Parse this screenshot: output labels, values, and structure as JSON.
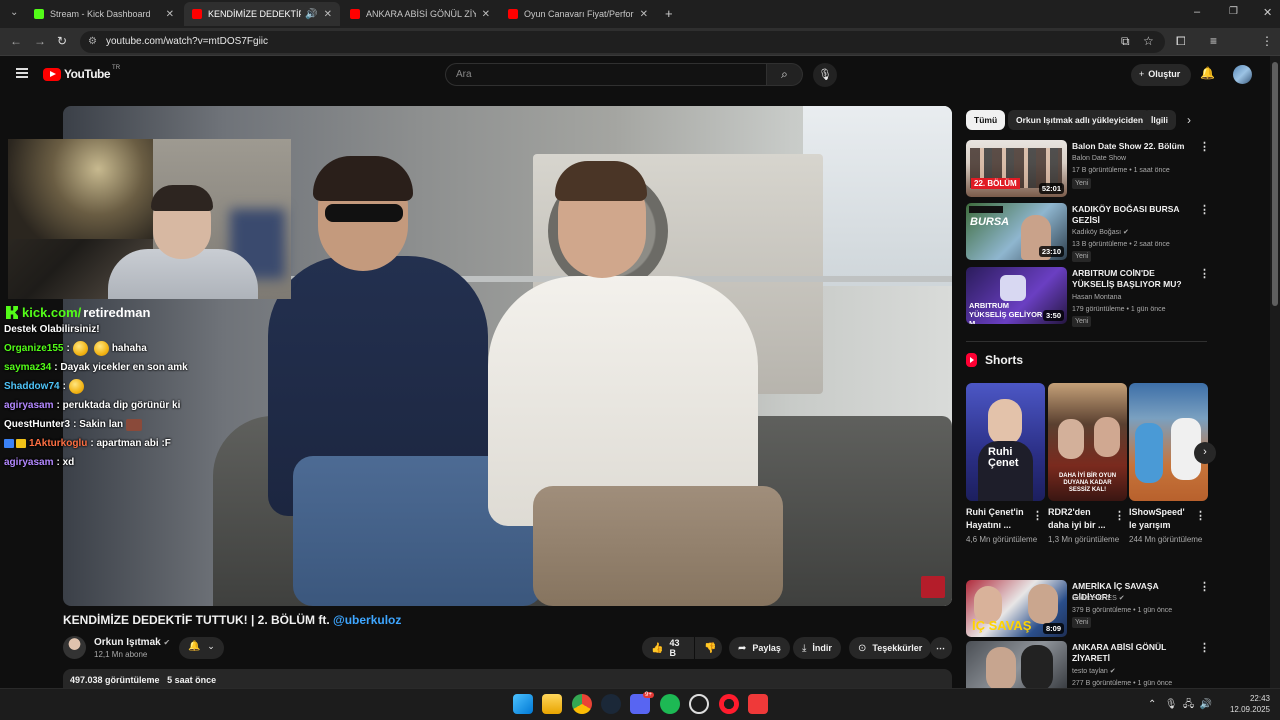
{
  "browser": {
    "tabs": [
      {
        "title": "Stream - Kick Dashboard",
        "favicon": "kick-icon",
        "active": false
      },
      {
        "title": "KENDİMİZE DEDEKTİF TUTT",
        "favicon": "youtube-icon",
        "active": true,
        "audio": true
      },
      {
        "title": "ANKARA ABİSİ GÖNÜL ZİYARE",
        "favicon": "youtube-icon",
        "active": false
      },
      {
        "title": "Oyun Canavarı Fiyat/Performan",
        "favicon": "youtube-icon",
        "active": false
      }
    ],
    "url": "youtube.com/watch?v=mtDOS7Fgiic"
  },
  "youtube": {
    "logo_text": "YouTube",
    "region": "TR",
    "search_placeholder": "Ara",
    "create_label": "Oluştur"
  },
  "video": {
    "title_main": "KENDİMİZE DEDEKTİF TUTTUK! | 2. BÖLÜM ft.",
    "title_mention": "@uberkuloz",
    "channel": "Orkun Işıtmak",
    "subscribers": "12,1 Mn abone",
    "likes": "43 B",
    "share_label": "Paylaş",
    "download_label": "İndir",
    "thanks_label": "Teşekkürler",
    "views": "497.038 görüntüleme",
    "posted": "5 saat önce"
  },
  "stream_overlay": {
    "brand": "kick.com/",
    "username": "retiredman",
    "chat": [
      {
        "name": "",
        "text": "Destek Olabilirsiniz!",
        "color": "#ffffff"
      },
      {
        "name": "Organize155",
        "text": "hahaha",
        "color": "#53fc18",
        "emojis": 2
      },
      {
        "name": "saymaz34",
        "text": "Dayak yicekler en son amk",
        "color": "#53fc18"
      },
      {
        "name": "Shaddow74",
        "text": "",
        "color": "#4fc3f7",
        "emojis": 1
      },
      {
        "name": "agiryasam",
        "text": "peruktada dip görünür ki",
        "color": "#b388ff"
      },
      {
        "name": "QuestHunter3",
        "text": "Sakin lan",
        "color": "#ffffff",
        "square": true
      },
      {
        "name": "1Akturkoglu",
        "text": "apartman abi :F",
        "color": "#ff7043",
        "badges": true
      },
      {
        "name": "agiryasam",
        "text": "xd",
        "color": "#b388ff"
      }
    ]
  },
  "sidebar": {
    "chips": [
      "Tümü",
      "Orkun Işıtmak adlı yükleyiciden",
      "İlgili"
    ],
    "recommendations": [
      {
        "title": "Balon Date Show 22. Bölüm",
        "channel": "Balon Date Show",
        "meta": "17 B görüntüleme • 1 saat önce",
        "badge": "Yeni",
        "duration": "52:01",
        "verified": false
      },
      {
        "title": "KADIKÖY BOĞASI BURSA GEZİSİ",
        "channel": "Kadıköy Boğası",
        "meta": "13 B görüntüleme • 2 saat önce",
        "badge": "Yeni",
        "duration": "23:10",
        "verified": true
      },
      {
        "title": "ARBITRUM COİN'DE YÜKSELİŞ BAŞLIYOR MU? ARB COİN ...",
        "channel": "Hasan Montana",
        "meta": "179 görüntüleme • 1 gün önce",
        "badge": "Yeni",
        "duration": "3:50",
        "verified": false
      },
      {
        "title": "AMERİKA İÇ SAVAŞA GİDİYOR!",
        "channel": "Sadece ENES",
        "meta": "379 B görüntüleme • 1 gün önce",
        "badge": "Yeni",
        "duration": "8:09",
        "verified": true
      },
      {
        "title": "ANKARA ABİSİ GÖNÜL ZİYARETİ",
        "channel": "testo taylan",
        "meta": "277 B görüntüleme • 1 gün önce",
        "badge": "",
        "duration": "",
        "verified": true
      }
    ],
    "shorts_title": "Shorts",
    "shorts": [
      {
        "title": "Ruhi Çenet'in Hayatını ...",
        "views": "4,6 Mn görüntüleme",
        "thumb_text": "Ruhi Çenet"
      },
      {
        "title": "RDR2'den daha iyi bir ...",
        "views": "1,3 Mn görüntüleme",
        "thumb_text": "DAHA İYİ BİR OYUN DUYANA KADAR SESSİZ KAL!"
      },
      {
        "title": "IShowSpeed' le yarışım",
        "views": "244 Mn görüntüleme",
        "thumb_text": ""
      }
    ]
  },
  "thumb_texts": {
    "bolum": "22. BÖLÜM",
    "bursa": "BURSA",
    "arbitrum": "ARBITRUM YÜKSELİŞ GELİYOR M",
    "icsavas": "İÇ SAVAŞ"
  },
  "taskbar": {
    "time": "22:43",
    "date": "12.09.2025",
    "discord_badge": "9+"
  },
  "colors": {
    "accent_red": "#ff0000",
    "kick_green": "#53fc18",
    "link_blue": "#3ea6ff",
    "bg": "#0f0f0f"
  }
}
